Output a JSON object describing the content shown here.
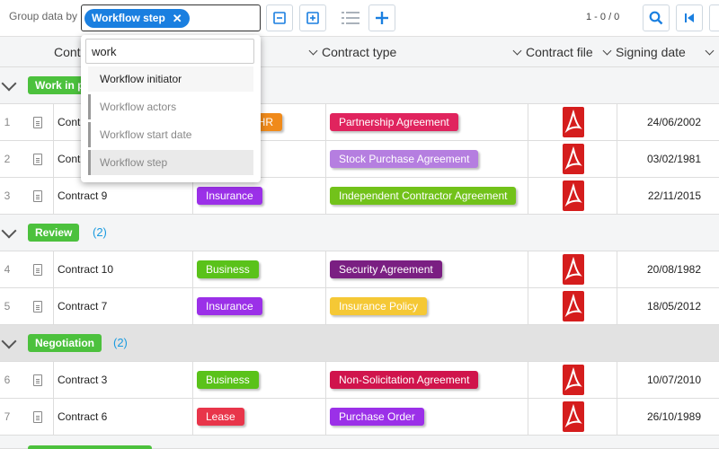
{
  "toolbar": {
    "group_label": "Group data by",
    "group_chip": "Workflow step",
    "chip_close": "✕",
    "pager": "1 - 0 / 0"
  },
  "columns": {
    "name": "Contract",
    "type": "Contract type",
    "file": "Contract file",
    "date": "Signing date"
  },
  "popup": {
    "search_value": "work",
    "items": [
      "Workflow initiator",
      "Workflow actors",
      "Workflow start date",
      "Workflow step"
    ]
  },
  "groups": [
    {
      "label": "Work in p",
      "count": ""
    },
    {
      "label": "Review",
      "count": "(2)"
    },
    {
      "label": "Negotiation",
      "count": "(2)"
    }
  ],
  "rows": [
    {
      "num": "1",
      "name": "Contract",
      "category": "t/HR",
      "category_color": "#f08a1a",
      "type": "Partnership Agreement",
      "type_color": "#e0245e",
      "date": "24/06/2002"
    },
    {
      "num": "2",
      "name": "Cont",
      "category": "",
      "category_color": "",
      "type": "Stock Purchase Agreement",
      "type_color": "#b57ee0",
      "date": "03/02/1981"
    },
    {
      "num": "3",
      "name": "Contract 9",
      "category": "Insurance",
      "category_color": "#9b30e8",
      "type": "Independent Contractor Agreement",
      "type_color": "#72c21a",
      "date": "22/11/2015"
    },
    {
      "num": "4",
      "name": "Contract 10",
      "category": "Business",
      "category_color": "#5ac21a",
      "type": "Security Agreement",
      "type_color": "#7a1f82",
      "date": "20/08/1982"
    },
    {
      "num": "5",
      "name": "Contract 7",
      "category": "Insurance",
      "category_color": "#9b30e8",
      "type": "Insurance Policy",
      "type_color": "#f5c835",
      "date": "18/05/2012"
    },
    {
      "num": "6",
      "name": "Contract 3",
      "category": "Business",
      "category_color": "#5ac21a",
      "type": "Non-Solicitation Agreement",
      "type_color": "#d0144c",
      "date": "10/07/2010"
    },
    {
      "num": "7",
      "name": "Contract 6",
      "category": "Lease",
      "category_color": "#e8354a",
      "type": "Purchase Order",
      "type_color": "#9b30e8",
      "date": "26/10/1989"
    }
  ],
  "icons": {
    "collapse": "minus-square-icon",
    "expand": "plus-square-icon",
    "list": "list-icon",
    "add": "plus-icon",
    "search": "search-icon",
    "first": "first-page-icon",
    "file": "pdf-icon"
  }
}
